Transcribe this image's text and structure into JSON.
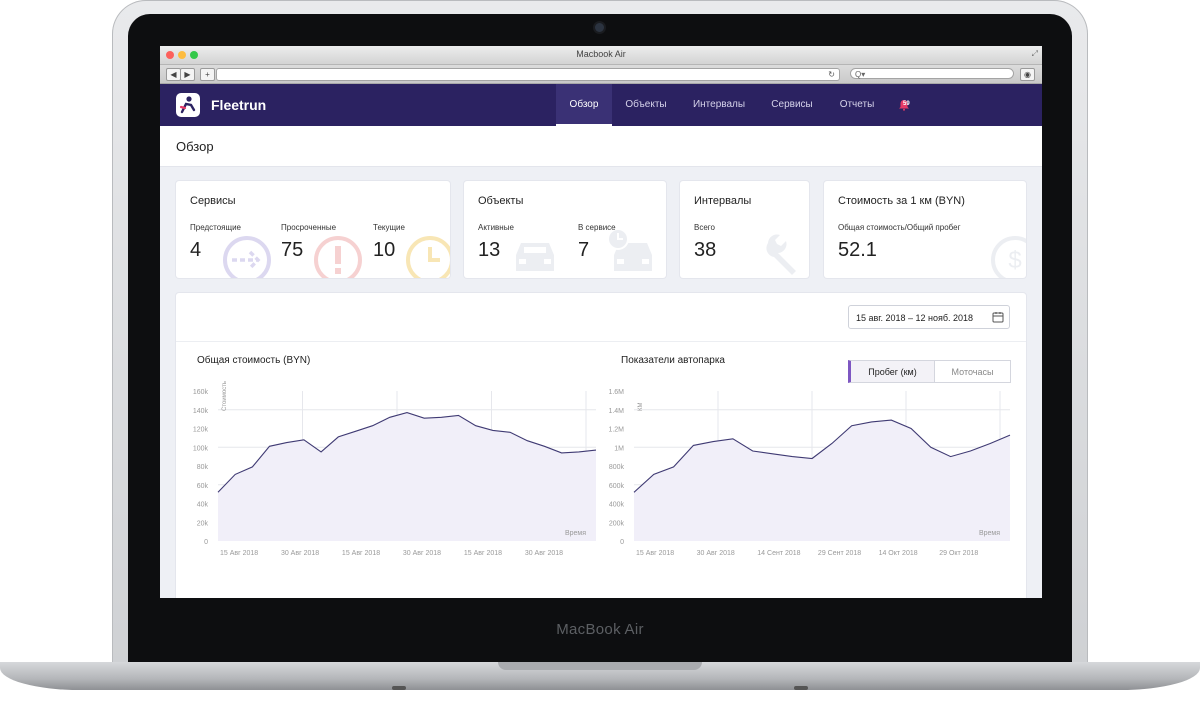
{
  "device": {
    "brand_label": "MacBook Air"
  },
  "browser": {
    "window_title": "Macbook Air",
    "back_glyph": "◀",
    "forward_glyph": "▶",
    "new_tab_glyph": "+",
    "reload_glyph": "↻",
    "search_glyph": "Q▾"
  },
  "app": {
    "name": "Fleetrun",
    "nav": [
      {
        "label": "Обзор",
        "active": true
      },
      {
        "label": "Объекты",
        "active": false
      },
      {
        "label": "Интервалы",
        "active": false
      },
      {
        "label": "Сервисы",
        "active": false
      },
      {
        "label": "Отчеты",
        "active": false
      }
    ],
    "notifications_badge": "59",
    "page_title": "Обзор",
    "colors": {
      "nav_bg": "#2b2261",
      "accent": "#7e57c2",
      "chart_line": "#3f3a73",
      "chart_fill": "#f1eff9"
    }
  },
  "summary": {
    "services": {
      "title": "Сервисы",
      "items": [
        {
          "label": "Предстоящие",
          "value": "4",
          "icon": "arrow-right-circle-icon"
        },
        {
          "label": "Просроченные",
          "value": "75",
          "icon": "alert-circle-icon"
        },
        {
          "label": "Текущие",
          "value": "10",
          "icon": "clock-icon"
        }
      ]
    },
    "objects": {
      "title": "Объекты",
      "items": [
        {
          "label": "Активные",
          "value": "13",
          "icon": "car-icon"
        },
        {
          "label": "В сервисе",
          "value": "7",
          "icon": "car-clock-icon"
        }
      ]
    },
    "intervals": {
      "title": "Интервалы",
      "items": [
        {
          "label": "Всего",
          "value": "38",
          "icon": "wrench-icon"
        }
      ]
    },
    "cost_per_km": {
      "title": "Стоимость за 1 км (BYN)",
      "items": [
        {
          "label": "Общая стоимость/Общий пробег",
          "value": "52.1",
          "icon": "dollar-circle-icon"
        }
      ]
    }
  },
  "filters": {
    "date_range": "15 авг. 2018 – 12 нояб. 2018"
  },
  "toggle": {
    "options": [
      "Пробег (км)",
      "Моточасы"
    ],
    "selected": "Пробег (км)"
  },
  "chart_data": [
    {
      "type": "area",
      "title": "Общая стоимость (BYN)",
      "ylabel": "Стоимость",
      "xlabel": "Время",
      "y_ticks": [
        "0",
        "20k",
        "40k",
        "60k",
        "80k",
        "100k",
        "120k",
        "140k",
        "160k"
      ],
      "ylim": [
        0,
        160000
      ],
      "x_ticks": [
        "15 Авг 2018",
        "30 Авг 2018",
        "15 Авг 2018",
        "30 Авг 2018",
        "15 Авг 2018",
        "30 Авг 2018"
      ],
      "grid": true,
      "series": [
        {
          "values": [
            52000,
            71000,
            79000,
            101000,
            105000,
            108000,
            95000,
            111000,
            117000,
            123000,
            132000,
            137000,
            131000,
            132000,
            134000,
            123000,
            118000,
            116000,
            107000,
            101000,
            94000,
            95000,
            97000
          ]
        }
      ]
    },
    {
      "type": "area",
      "title": "Показатели автопарка",
      "ylabel": "КМ",
      "xlabel": "Время",
      "y_ticks": [
        "0",
        "200k",
        "400k",
        "600k",
        "800k",
        "1M",
        "1.2M",
        "1.4M",
        "1.6M"
      ],
      "ylim": [
        0,
        1600000
      ],
      "x_ticks": [
        "15 Авг 2018",
        "30 Авг 2018",
        "14 Сент 2018",
        "29 Сент 2018",
        "14 Окт 2018",
        "29 Окт 2018"
      ],
      "grid": true,
      "series": [
        {
          "values": [
            520000,
            710000,
            790000,
            1020000,
            1060000,
            1090000,
            960000,
            930000,
            900000,
            880000,
            1040000,
            1230000,
            1270000,
            1290000,
            1200000,
            1000000,
            900000,
            960000,
            1040000,
            1130000
          ]
        }
      ]
    }
  ]
}
